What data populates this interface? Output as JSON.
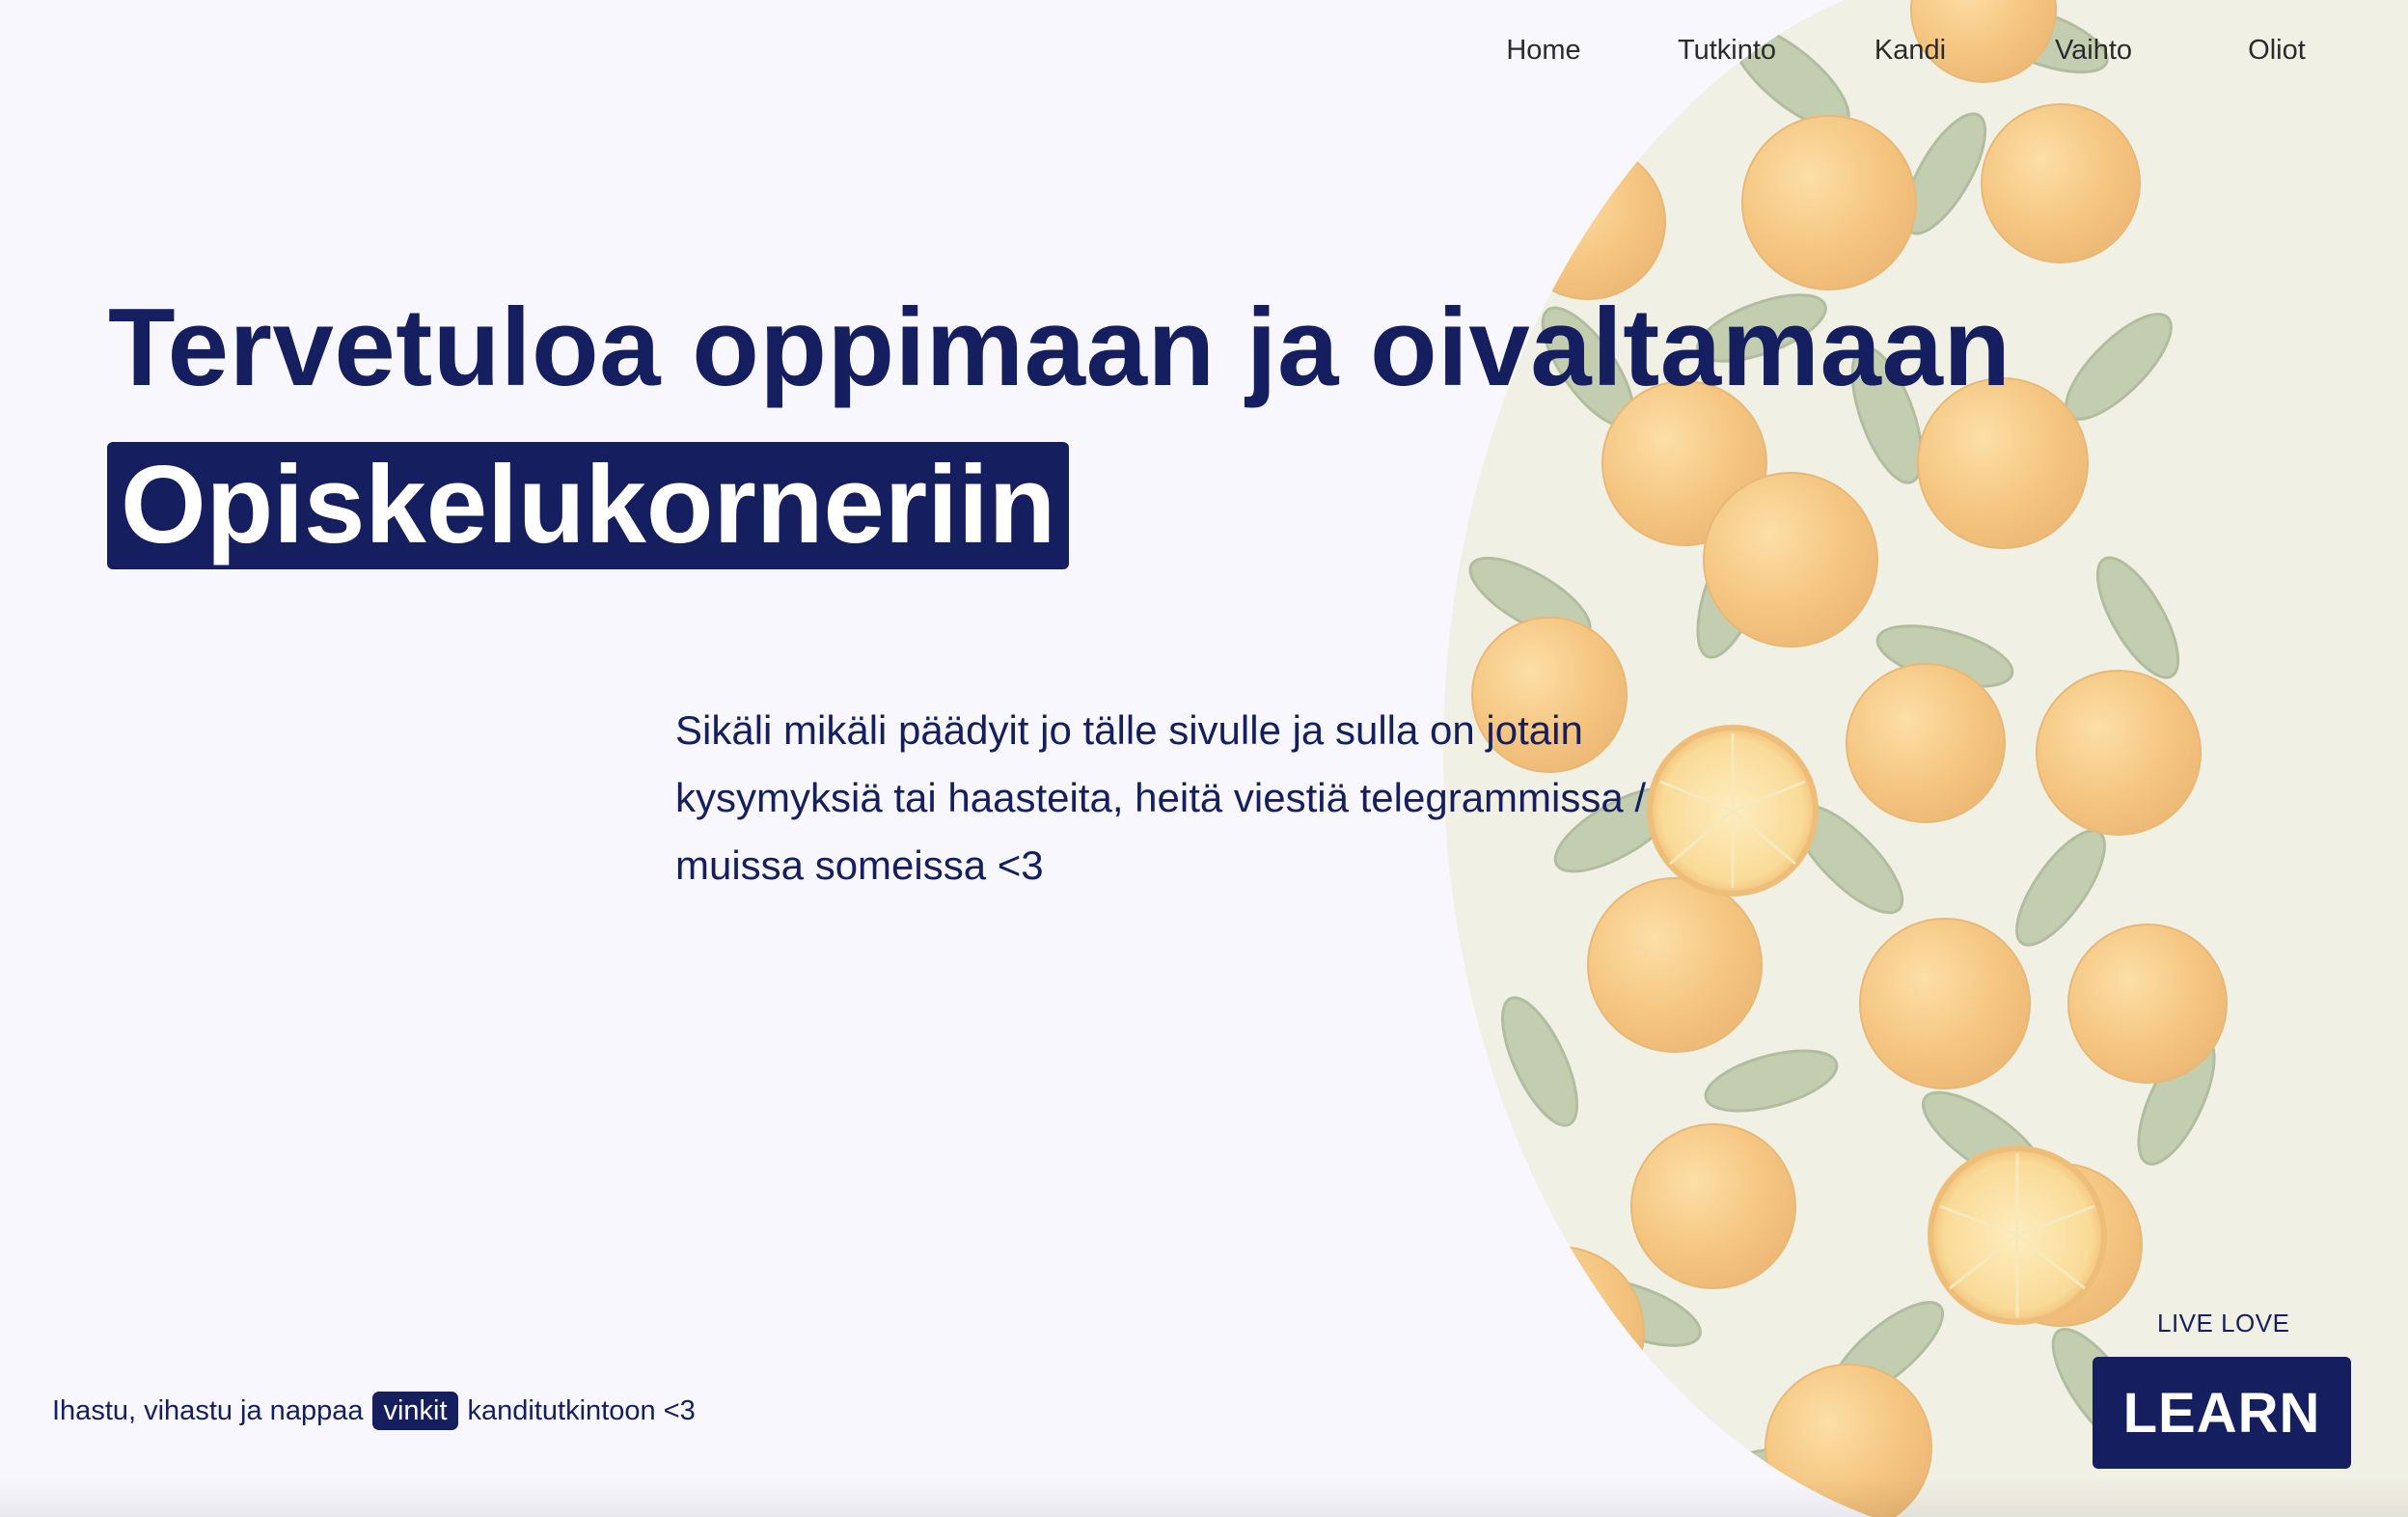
{
  "nav": {
    "items": [
      {
        "label": "Home"
      },
      {
        "label": "Tutkinto"
      },
      {
        "label": "Kandi"
      },
      {
        "label": "Vaihto"
      },
      {
        "label": "Oliot"
      }
    ]
  },
  "hero": {
    "title": "Tervetuloa oppimaan ja oivaltamaan",
    "highlight": "Opiskelukorneriin"
  },
  "intro": {
    "text": "Sikäli mikäli päädyit jo tälle sivulle ja sulla on jotain kysymyksiä tai haasteita, heitä viestiä telegrammissa / muissa someissa <3"
  },
  "tagline": {
    "before": "Ihastu, vihastu ja nappaa",
    "chip": "vinkit",
    "after": "kanditutkintoon <3"
  },
  "cta": {
    "eyebrow": "LIVE LOVE",
    "button": "LEARN"
  },
  "colors": {
    "navy": "#151e5e",
    "background": "#f8f7fd",
    "orange": "#f2b052",
    "leaf": "#9fb184"
  },
  "decoration": {
    "pattern_icon": "orange-fruit-pattern"
  }
}
